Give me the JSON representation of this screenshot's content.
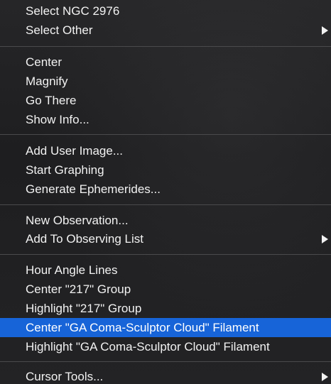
{
  "menu": {
    "groups": [
      [
        {
          "label": "Select NGC 2976",
          "submenu": false
        },
        {
          "label": "Select Other",
          "submenu": true
        }
      ],
      [
        {
          "label": "Center",
          "submenu": false
        },
        {
          "label": "Magnify",
          "submenu": false
        },
        {
          "label": "Go There",
          "submenu": false
        },
        {
          "label": "Show Info...",
          "submenu": false
        }
      ],
      [
        {
          "label": "Add User Image...",
          "submenu": false
        },
        {
          "label": "Start Graphing",
          "submenu": false
        },
        {
          "label": "Generate Ephemerides...",
          "submenu": false
        }
      ],
      [
        {
          "label": "New Observation...",
          "submenu": false
        },
        {
          "label": "Add To Observing List",
          "submenu": true
        }
      ],
      [
        {
          "label": "Hour Angle Lines",
          "submenu": false
        },
        {
          "label": "Center \"217\" Group",
          "submenu": false
        },
        {
          "label": "Highlight \"217\" Group",
          "submenu": false
        },
        {
          "label": "Center \"GA Coma-Sculptor Cloud\" Filament",
          "submenu": false,
          "highlighted": true
        },
        {
          "label": "Highlight \"GA Coma-Sculptor Cloud\" Filament",
          "submenu": false
        }
      ],
      [
        {
          "label": "Cursor Tools...",
          "submenu": true
        }
      ]
    ],
    "colors": {
      "background": "#1e1e20",
      "highlight": "#1764d8",
      "text": "#f2f2f2",
      "separator": "#4a4a4c"
    }
  }
}
